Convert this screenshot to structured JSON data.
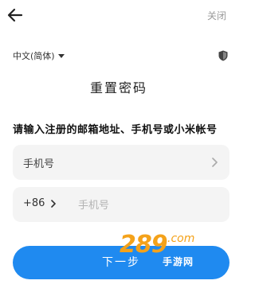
{
  "header": {
    "close_label": "关闭"
  },
  "language": {
    "selected": "中文(简体)"
  },
  "page": {
    "title": "重置密码",
    "subtitle": "请输入注册的邮箱地址、手机号或小米帐号"
  },
  "form": {
    "account_type_label": "手机号",
    "country_code": "+86",
    "phone_placeholder": "手机号",
    "phone_value": ""
  },
  "actions": {
    "next_label": "下一步"
  },
  "watermark": {
    "brand": "289",
    "suffix": ".com",
    "tagline": "手游网"
  },
  "colors": {
    "accent": "#1f8af0",
    "field_bg": "#f4f4f4",
    "watermark": "#f4a21a"
  },
  "icons": {
    "back": "arrow-left-icon",
    "language_caret": "caret-down-icon",
    "security": "shield-icon",
    "field_chevron": "chevron-right-icon"
  }
}
